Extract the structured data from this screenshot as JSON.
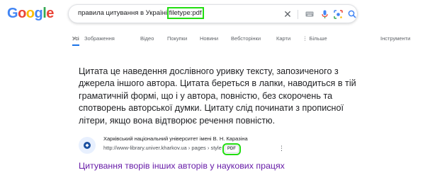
{
  "logo": {
    "letters": [
      "G",
      "o",
      "o",
      "g",
      "l",
      "e"
    ],
    "colors": [
      "#4285f4",
      "#ea4335",
      "#fbbc05",
      "#4285f4",
      "#34a853",
      "#ea4335"
    ]
  },
  "search": {
    "query_prefix": "правила цитування в Україні ",
    "query_highlight": "filetype:pdf",
    "highlight_color": "#22dd11"
  },
  "icons": {
    "clear": "close-icon",
    "keyboard": "keyboard-icon",
    "mic": "mic-icon",
    "lens": "lens-icon",
    "search": "search-icon"
  },
  "tabs": {
    "all": "Усі",
    "images": "Зображення",
    "videos": "Відео",
    "shopping": "Покупки",
    "news": "Новини",
    "web": "Вебсторінки",
    "maps": "Карти",
    "more": "⋮ Більше",
    "tools": "Інструменти"
  },
  "snippet": {
    "text": "Цитата це наведення дослівного уривку тексту, запозиченого з джерела іншого автора. Цитата береться в лапки, наводиться в тій граматичній формі, що і у автора, повністю, без скорочень та спотворень авторської думки. Цитату слід починати з прописної літери, якщо вона відтворює речення повністю."
  },
  "result": {
    "source_name": "Харківський національний університет імені В. Н. Каразіна",
    "source_url": "http://www-library.univer.kharkov.ua › pages › style",
    "badge": "PDF",
    "title": "Цитування творів інших авторів у наукових працях"
  }
}
